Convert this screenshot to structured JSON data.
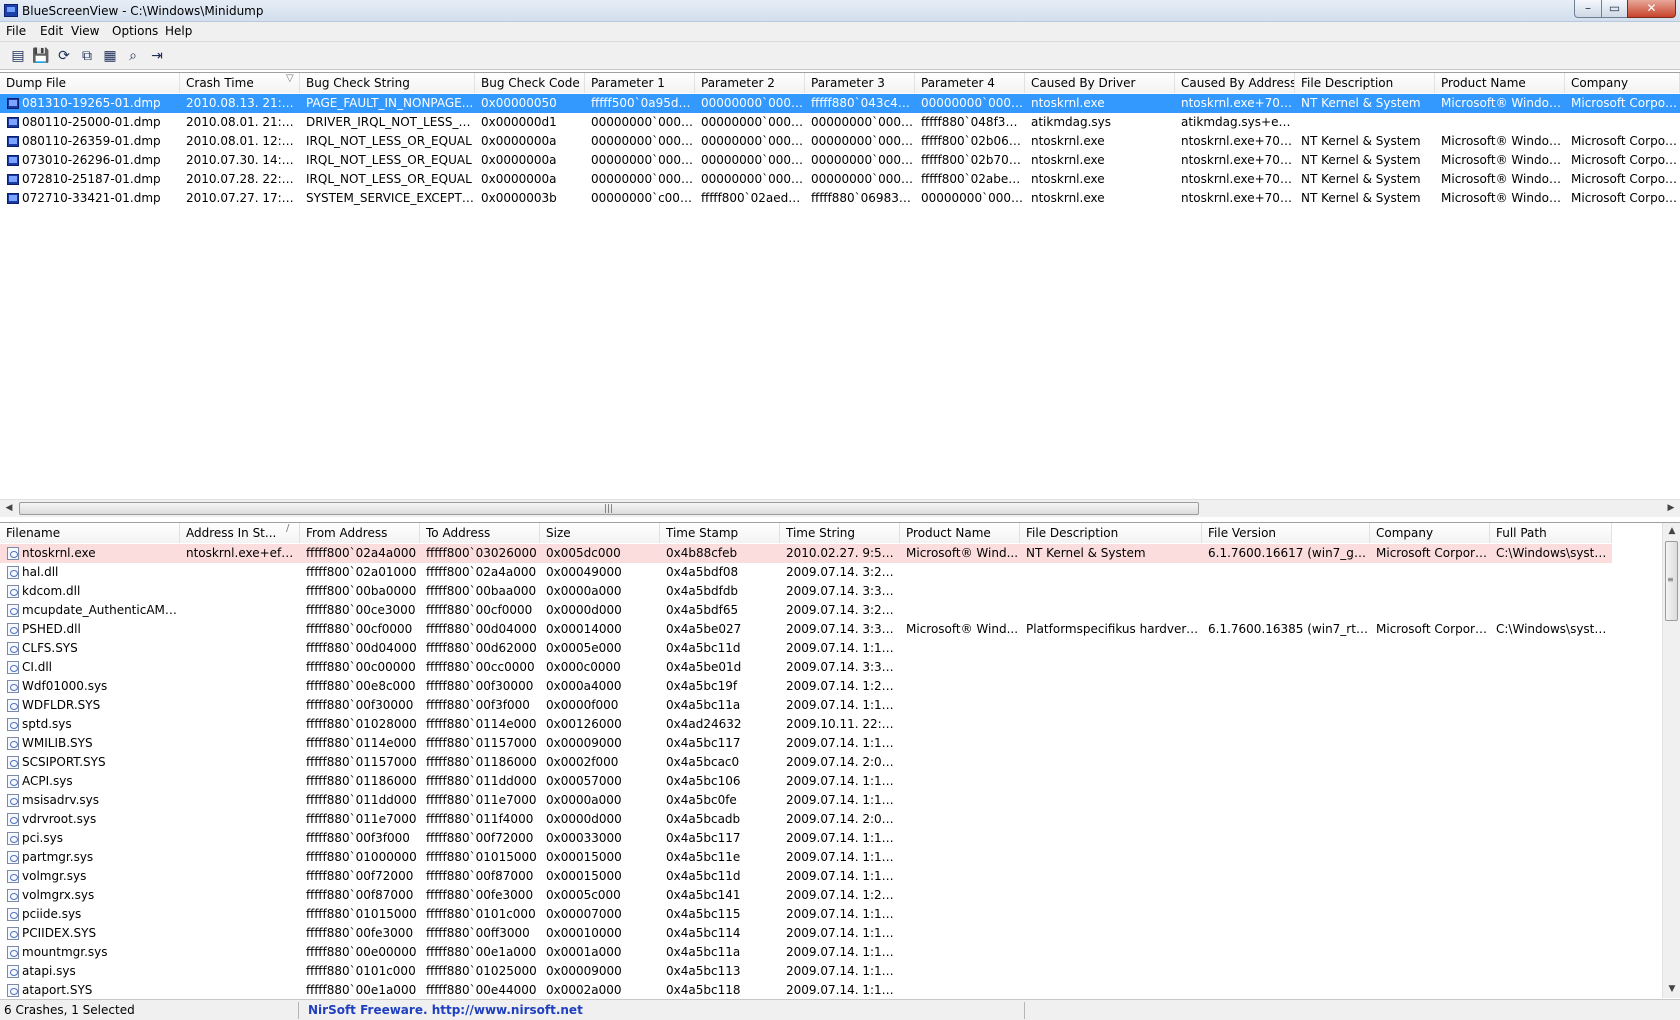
{
  "window": {
    "title": "BlueScreenView  -  C:\\Windows\\Minidump",
    "min": "–",
    "max": "▭",
    "close": "✕"
  },
  "menu": [
    {
      "label": "File",
      "underline": "F"
    },
    {
      "label": "Edit",
      "underline": "E"
    },
    {
      "label": "View",
      "underline": "V"
    },
    {
      "label": "Options",
      "underline": "O"
    },
    {
      "label": "Help",
      "underline": "H"
    }
  ],
  "toolbar": [
    {
      "icon": "html-report-icon",
      "glyph": "▤"
    },
    {
      "icon": "save-icon",
      "glyph": "💾"
    },
    {
      "icon": "refresh-icon",
      "glyph": "⟳"
    },
    {
      "icon": "copy-icon",
      "glyph": "⧉"
    },
    {
      "icon": "properties-icon",
      "glyph": "▦"
    },
    {
      "icon": "find-icon",
      "glyph": "⌕"
    },
    {
      "icon": "exit-icon",
      "glyph": "⇥"
    }
  ],
  "crash_table": {
    "columns": [
      "Dump File",
      "Crash Time",
      "Bug Check String",
      "Bug Check Code",
      "Parameter 1",
      "Parameter 2",
      "Parameter 3",
      "Parameter 4",
      "Caused By Driver",
      "Caused By Address",
      "File Description",
      "Product Name",
      "Company"
    ],
    "sort_indicator": "▽",
    "rows": [
      [
        "081310-19265-01.dmp",
        "2010.08.13. 21:38:45",
        "PAGE_FAULT_IN_NONPAGE...",
        "0x00000050",
        "fffff500`0a95d4e1",
        "00000000`000000...",
        "fffff880`043c4397",
        "00000000`000000...",
        "ntoskrnl.exe",
        "ntoskrnl.exe+70600",
        "NT Kernel & System",
        "Microsoft® Window...",
        "Microsoft Corpora..."
      ],
      [
        "080110-25000-01.dmp",
        "2010.08.01. 21:51:08",
        "DRIVER_IRQL_NOT_LESS_OR_...",
        "0x000000d1",
        "00000000`000000...",
        "00000000`000000...",
        "00000000`000000...",
        "fffff880`048f3459",
        "atikmdag.sys",
        "atikmdag.sys+ea459",
        "",
        "",
        ""
      ],
      [
        "080110-26359-01.dmp",
        "2010.08.01. 12:27:54",
        "IRQL_NOT_LESS_OR_EQUAL",
        "0x0000000a",
        "00000000`000000...",
        "00000000`000000...",
        "00000000`000000...",
        "fffff800`02b06410",
        "ntoskrnl.exe",
        "ntoskrnl.exe+70600",
        "NT Kernel & System",
        "Microsoft® Window...",
        "Microsoft Corpora..."
      ],
      [
        "073010-26296-01.dmp",
        "2010.07.30. 14:26:23",
        "IRQL_NOT_LESS_OR_EQUAL",
        "0x0000000a",
        "00000000`000488...",
        "00000000`000000...",
        "00000000`000000...",
        "fffff800`02b70a5f",
        "ntoskrnl.exe",
        "ntoskrnl.exe+70600",
        "NT Kernel & System",
        "Microsoft® Window...",
        "Microsoft Corpora..."
      ],
      [
        "072810-25187-01.dmp",
        "2010.07.28. 22:16:36",
        "IRQL_NOT_LESS_OR_EQUAL",
        "0x0000000a",
        "00000000`00074b...",
        "00000000`000000...",
        "00000000`000000...",
        "fffff800`02abe19d",
        "ntoskrnl.exe",
        "ntoskrnl.exe+70600",
        "NT Kernel & System",
        "Microsoft® Window...",
        "Microsoft Corpora..."
      ],
      [
        "072710-33421-01.dmp",
        "2010.07.27. 17:32:51",
        "SYSTEM_SERVICE_EXCEPTION",
        "0x0000003b",
        "00000000`c00000...",
        "fffff800`02aed84d",
        "fffff880`06983690",
        "00000000`000000...",
        "ntoskrnl.exe",
        "ntoskrnl.exe+70600",
        "NT Kernel & System",
        "Microsoft® Window...",
        "Microsoft Corpora..."
      ]
    ]
  },
  "module_table": {
    "columns": [
      "Filename",
      "Address In St...",
      "From Address",
      "To Address",
      "Size",
      "Time Stamp",
      "Time String",
      "Product Name",
      "File Description",
      "File Version",
      "Company",
      "Full Path"
    ],
    "sort_indicator": "/",
    "rows": [
      [
        "ntoskrnl.exe",
        "ntoskrnl.exe+ef789",
        "fffff800`02a4a000",
        "fffff800`03026000",
        "0x005dc000",
        "0x4b88cfeb",
        "2010.02.27. 9:55:23",
        "Microsoft® Wind...",
        "NT Kernel & System",
        "6.1.7600.16617 (win7_gdr.10...",
        "Microsoft Corpora...",
        "C:\\Windows\\syste..."
      ],
      [
        "hal.dll",
        "",
        "fffff800`02a01000",
        "fffff800`02a4a000",
        "0x00049000",
        "0x4a5bdf08",
        "2009.07.14. 3:27:36",
        "",
        "",
        "",
        "",
        ""
      ],
      [
        "kdcom.dll",
        "",
        "fffff800`00ba0000",
        "fffff800`00baa000",
        "0x0000a000",
        "0x4a5bdfdb",
        "2009.07.14. 3:31:07",
        "",
        "",
        "",
        "",
        ""
      ],
      [
        "mcupdate_AuthenticAMD.dll",
        "",
        "fffff880`00ce3000",
        "fffff880`00cf0000",
        "0x0000d000",
        "0x4a5bdf65",
        "2009.07.14. 3:29:09",
        "",
        "",
        "",
        "",
        ""
      ],
      [
        "PSHED.dll",
        "",
        "fffff880`00cf0000",
        "fffff880`00d04000",
        "0x00014000",
        "0x4a5be027",
        "2009.07.14. 3:32:23",
        "Microsoft® Wind...",
        "Platformspecifikus hardverhib...",
        "6.1.7600.16385 (win7_rtm.09...",
        "Microsoft Corpora...",
        "C:\\Windows\\syste..."
      ],
      [
        "CLFS.SYS",
        "",
        "fffff880`00d04000",
        "fffff880`00d62000",
        "0x0005e000",
        "0x4a5bc11d",
        "2009.07.14. 1:19:57",
        "",
        "",
        "",
        "",
        ""
      ],
      [
        "CI.dll",
        "",
        "fffff880`00c00000",
        "fffff880`00cc0000",
        "0x000c0000",
        "0x4a5be01d",
        "2009.07.14. 3:32:13",
        "",
        "",
        "",
        "",
        ""
      ],
      [
        "Wdf01000.sys",
        "",
        "fffff880`00e8c000",
        "fffff880`00f30000",
        "0x000a4000",
        "0x4a5bc19f",
        "2009.07.14. 1:22:07",
        "",
        "",
        "",
        "",
        ""
      ],
      [
        "WDFLDR.SYS",
        "",
        "fffff880`00f30000",
        "fffff880`00f3f000",
        "0x0000f000",
        "0x4a5bc11a",
        "2009.07.14. 1:19:54",
        "",
        "",
        "",
        "",
        ""
      ],
      [
        "sptd.sys",
        "",
        "fffff880`01028000",
        "fffff880`0114e000",
        "0x00126000",
        "0x4ad24632",
        "2009.10.11. 22:55:14",
        "",
        "",
        "",
        "",
        ""
      ],
      [
        "WMILIB.SYS",
        "",
        "fffff880`0114e000",
        "fffff880`01157000",
        "0x00009000",
        "0x4a5bc117",
        "2009.07.14. 1:19:51",
        "",
        "",
        "",
        "",
        ""
      ],
      [
        "SCSIPORT.SYS",
        "",
        "fffff880`01157000",
        "fffff880`01186000",
        "0x0002f000",
        "0x4a5bcac0",
        "2009.07.14. 2:01:04",
        "",
        "",
        "",
        "",
        ""
      ],
      [
        "ACPI.sys",
        "",
        "fffff880`01186000",
        "fffff880`011dd000",
        "0x00057000",
        "0x4a5bc106",
        "2009.07.14. 1:19:34",
        "",
        "",
        "",
        "",
        ""
      ],
      [
        "msisadrv.sys",
        "",
        "fffff880`011dd000",
        "fffff880`011e7000",
        "0x0000a000",
        "0x4a5bc0fe",
        "2009.07.14. 1:19:26",
        "",
        "",
        "",
        "",
        ""
      ],
      [
        "vdrvroot.sys",
        "",
        "fffff880`011e7000",
        "fffff880`011f4000",
        "0x0000d000",
        "0x4a5bcadb",
        "2009.07.14. 2:01:31",
        "",
        "",
        "",
        "",
        ""
      ],
      [
        "pci.sys",
        "",
        "fffff880`00f3f000",
        "fffff880`00f72000",
        "0x00033000",
        "0x4a5bc117",
        "2009.07.14. 1:19:51",
        "",
        "",
        "",
        "",
        ""
      ],
      [
        "partmgr.sys",
        "",
        "fffff880`01000000",
        "fffff880`01015000",
        "0x00015000",
        "0x4a5bc11e",
        "2009.07.14. 1:19:58",
        "",
        "",
        "",
        "",
        ""
      ],
      [
        "volmgr.sys",
        "",
        "fffff880`00f72000",
        "fffff880`00f87000",
        "0x00015000",
        "0x4a5bc11d",
        "2009.07.14. 1:19:57",
        "",
        "",
        "",
        "",
        ""
      ],
      [
        "volmgrx.sys",
        "",
        "fffff880`00f87000",
        "fffff880`00fe3000",
        "0x0005c000",
        "0x4a5bc141",
        "2009.07.14. 1:20:33",
        "",
        "",
        "",
        "",
        ""
      ],
      [
        "pciide.sys",
        "",
        "fffff880`01015000",
        "fffff880`0101c000",
        "0x00007000",
        "0x4a5bc115",
        "2009.07.14. 1:19:49",
        "",
        "",
        "",
        "",
        ""
      ],
      [
        "PCIIDEX.SYS",
        "",
        "fffff880`00fe3000",
        "fffff880`00ff3000",
        "0x00010000",
        "0x4a5bc114",
        "2009.07.14. 1:19:48",
        "",
        "",
        "",
        "",
        ""
      ],
      [
        "mountmgr.sys",
        "",
        "fffff880`00e00000",
        "fffff880`00e1a000",
        "0x0001a000",
        "0x4a5bc11a",
        "2009.07.14. 1:19:54",
        "",
        "",
        "",
        "",
        ""
      ],
      [
        "atapi.sys",
        "",
        "fffff880`0101c000",
        "fffff880`01025000",
        "0x00009000",
        "0x4a5bc113",
        "2009.07.14. 1:19:47",
        "",
        "",
        "",
        "",
        ""
      ],
      [
        "ataport.SYS",
        "",
        "fffff880`00e1a000",
        "fffff880`00e44000",
        "0x0002a000",
        "0x4a5bc118",
        "2009.07.14. 1:19:52",
        "",
        "",
        "",
        "",
        ""
      ]
    ]
  },
  "status": {
    "summary": "6 Crashes, 1 Selected",
    "credit": "NirSoft Freeware.  http://www.nirsoft.net"
  },
  "colors": {
    "selection": "#3399ff",
    "highlight_row": "#fbdddd",
    "link": "#1f3fbf"
  }
}
